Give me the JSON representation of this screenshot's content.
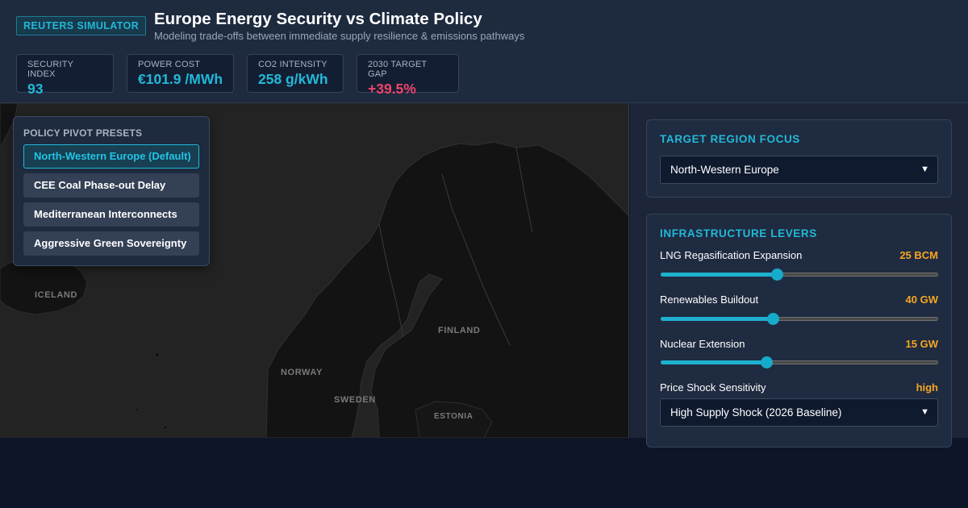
{
  "header": {
    "badge": "REUTERS SIMULATOR",
    "title": "Europe Energy Security vs Climate Policy",
    "subtitle": "Modeling trade-offs between immediate supply resilience & emissions pathways"
  },
  "kpis": [
    {
      "label": "SECURITY INDEX",
      "value": "93",
      "status": "normal"
    },
    {
      "label": "POWER COST",
      "value": "€101.9 /MWh",
      "status": "normal"
    },
    {
      "label": "CO2 INTENSITY",
      "value": "258 g/kWh",
      "status": "normal"
    },
    {
      "label": "2030 TARGET GAP",
      "value": "+39.5%",
      "status": "warn"
    }
  ],
  "map": {
    "labels": {
      "iceland": "ICELAND",
      "norway": "NORWAY",
      "sweden": "SWEDEN",
      "finland": "FINLAND",
      "estonia": "ESTONIA"
    }
  },
  "presets": {
    "title": "POLICY PIVOT PRESETS",
    "items": [
      {
        "label": "North-Western Europe (Default)",
        "active": true
      },
      {
        "label": "CEE Coal Phase-out Delay",
        "active": false
      },
      {
        "label": "Mediterranean Interconnects",
        "active": false
      },
      {
        "label": "Aggressive Green Sovereignty",
        "active": false
      }
    ]
  },
  "region": {
    "title": "TARGET REGION FOCUS",
    "selected": "North-Western Europe"
  },
  "levers": {
    "title": "INFRASTRUCTURE LEVERS",
    "lng": {
      "label": "LNG Regasification Expansion",
      "value": "25 BCM",
      "fraction": 0.42
    },
    "renewables": {
      "label": "Renewables Buildout",
      "value": "40 GW",
      "fraction": 0.405
    },
    "nuclear": {
      "label": "Nuclear Extension",
      "value": "15 GW",
      "fraction": 0.38
    },
    "shock": {
      "label": "Price Shock Sensitivity",
      "value": "high",
      "selected": "High Supply Shock (2026 Baseline)"
    }
  },
  "colors": {
    "accent": "#22b8d8",
    "warn": "#f0456a",
    "lever_value": "#f5a623",
    "panel": "#1e2a3e",
    "background": "#0d1529"
  }
}
